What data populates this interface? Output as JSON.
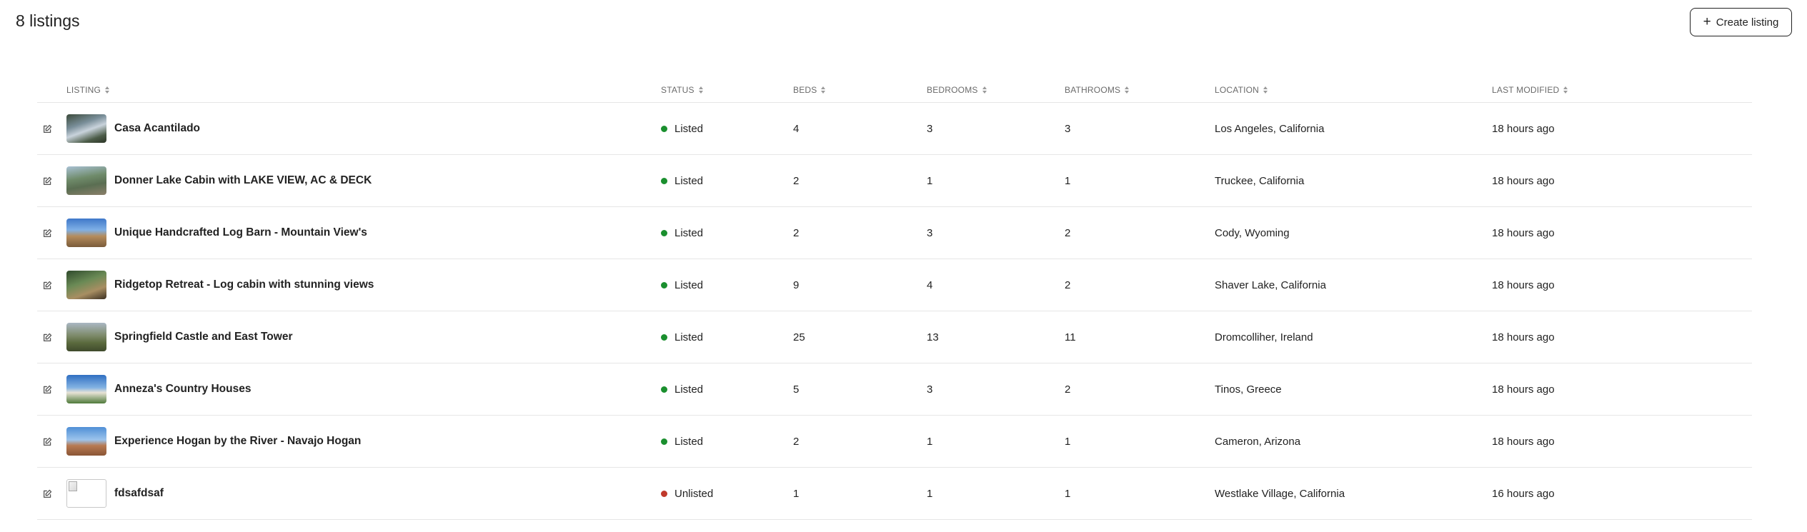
{
  "header": {
    "title": "8 listings",
    "create_label": "Create listing"
  },
  "columns": {
    "listing": "LISTING",
    "status": "STATUS",
    "beds": "BEDS",
    "bedrooms": "BEDROOMS",
    "bathrooms": "BATHROOMS",
    "location": "LOCATION",
    "last_modified": "LAST MODIFIED"
  },
  "colors": {
    "listed": "#1a8f2e",
    "unlisted": "#c0392b"
  },
  "listings": [
    {
      "name": "Casa Acantilado",
      "status": "Listed",
      "beds": "4",
      "bedrooms": "3",
      "bathrooms": "3",
      "location": "Los Angeles, California",
      "modified": "18 hours ago"
    },
    {
      "name": "Donner Lake Cabin with LAKE VIEW, AC & DECK",
      "status": "Listed",
      "beds": "2",
      "bedrooms": "1",
      "bathrooms": "1",
      "location": "Truckee, California",
      "modified": "18 hours ago"
    },
    {
      "name": "Unique Handcrafted Log Barn - Mountain View's",
      "status": "Listed",
      "beds": "2",
      "bedrooms": "3",
      "bathrooms": "2",
      "location": "Cody, Wyoming",
      "modified": "18 hours ago"
    },
    {
      "name": "Ridgetop Retreat - Log cabin with stunning views",
      "status": "Listed",
      "beds": "9",
      "bedrooms": "4",
      "bathrooms": "2",
      "location": "Shaver Lake, California",
      "modified": "18 hours ago"
    },
    {
      "name": "Springfield Castle and East Tower",
      "status": "Listed",
      "beds": "25",
      "bedrooms": "13",
      "bathrooms": "11",
      "location": "Dromcolliher, Ireland",
      "modified": "18 hours ago"
    },
    {
      "name": "Anneza's Country Houses",
      "status": "Listed",
      "beds": "5",
      "bedrooms": "3",
      "bathrooms": "2",
      "location": "Tinos, Greece",
      "modified": "18 hours ago"
    },
    {
      "name": "Experience Hogan by the River - Navajo Hogan",
      "status": "Listed",
      "beds": "2",
      "bedrooms": "1",
      "bathrooms": "1",
      "location": "Cameron, Arizona",
      "modified": "18 hours ago"
    },
    {
      "name": "fdsafdsaf",
      "status": "Unlisted",
      "beds": "1",
      "bedrooms": "1",
      "bathrooms": "1",
      "location": "Westlake Village, California",
      "modified": "16 hours ago"
    }
  ]
}
